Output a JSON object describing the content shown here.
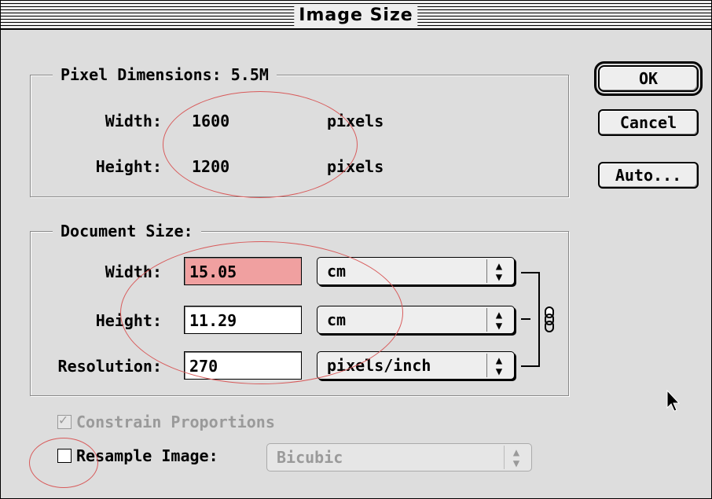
{
  "window": {
    "title": "Image Size"
  },
  "pixel_dimensions": {
    "title": "Pixel Dimensions:  5.5M",
    "width_label": "Width:",
    "width_value": "1600",
    "width_unit": "pixels",
    "height_label": "Height:",
    "height_value": "1200",
    "height_unit": "pixels"
  },
  "document_size": {
    "title": "Document Size:",
    "width_label": "Width:",
    "width_value": "15.05",
    "width_unit": "cm",
    "height_label": "Height:",
    "height_value": "11.29",
    "height_unit": "cm",
    "resolution_label": "Resolution:",
    "resolution_value": "270",
    "resolution_unit": "pixels/inch"
  },
  "buttons": {
    "ok": "OK",
    "cancel": "Cancel",
    "auto": "Auto..."
  },
  "options": {
    "constrain_label": "Constrain Proportions",
    "constrain_checked": true,
    "constrain_enabled": false,
    "resample_label": "Resample Image:",
    "resample_checked": false,
    "resample_method": "Bicubic",
    "resample_enabled": false
  },
  "colors": {
    "highlight_field": "#f0a0a0",
    "annotation_circle": "#d85b5b"
  },
  "icons": {
    "popup_arrows": "up-down-arrows-icon",
    "link": "chain-link-icon",
    "cursor": "arrow-cursor-icon"
  }
}
